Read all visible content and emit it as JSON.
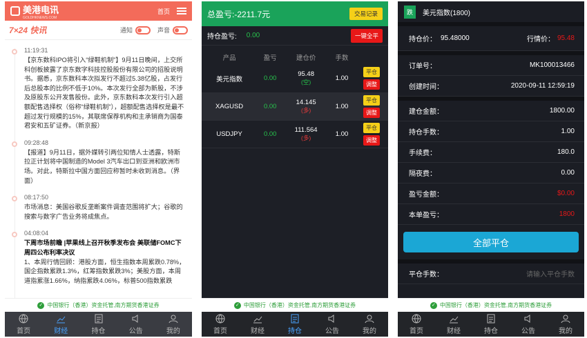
{
  "colors": {
    "brand": "#f36b5a",
    "profit_green": "#1aa35a",
    "loss_red": "#e81818",
    "accent_blue": "#1ba7d5",
    "nav_active": "#4aa3ff"
  },
  "news": {
    "logo": "美港电讯",
    "logo_sub": "GOLDHKNEWS.COM",
    "home": "首页",
    "section": "7×24 快讯",
    "toggle1": "通知",
    "toggle2": "声音",
    "items": [
      {
        "time": "11:19:31",
        "text": "【京东数科IPO将引入“绿鞋机制”】9月11日晚间，上交所科创板披露了京东数字科技控股股份有限公司的招股说明书。据悉，京东数科本次拟发行不超过5.38亿股，占发行后总股本的比例不低于10%。本次发行全部为新股，不涉及原股东公开发售股份。此外，京东数科本次发行引入超额配售选择权（俗称“绿鞋机制”），超额配售选择权是最不超过发行规模的15%，其联席保荐机构和主承销商为国泰君安和五矿证券。（新京报）"
      },
      {
        "time": "09:28:48",
        "text": "【报道】9月11日，据外媒转引两位知情人士透露，特斯拉正计划将中国制造的Model 3汽车出口到亚洲和欧洲市场。对此，特斯拉中国方面回应称暂时未收到消息。（界面）"
      },
      {
        "time": "08:17:50",
        "text": "市场消息：美国谷歌反垄断案件调查范围将扩大；谷歌的搜索与数字广告业务将成焦点。"
      },
      {
        "time": "04:08:04",
        "title": "下周市场前瞻 |苹果线上召开秋季发布会 美联储FOMC下周四公布利率决议",
        "text": "1、本周行情回顾：港股方面，恒生指数本周累跌0.78%，国企指数累跌1.3%，红筹指数累跌3%；美股方面，本周道指累涨1.66%，纳指累跌4.06%，标普500指数累跌"
      }
    ]
  },
  "banner": "中国银行（香港）资金托管,南方期货香港证券",
  "nav": [
    "首页",
    "财经",
    "持仓",
    "公告",
    "我的"
  ],
  "holdings": {
    "total_label": "总盈亏:",
    "total_value": "-2211.7元",
    "records_btn": "交易记录",
    "hold_label": "持仓盈亏:",
    "hold_value": "0.00",
    "close_all_btn": "一键全平",
    "columns": [
      "产品",
      "盈亏",
      "建仓价",
      "手数",
      ""
    ],
    "rows": [
      {
        "product": "美元指数",
        "pnl": "0.00",
        "price": "95.48",
        "dir": "(空)",
        "dir_type": "g",
        "lots": "1.00",
        "close": "平仓",
        "adjust": "调整"
      },
      {
        "product": "XAGUSD",
        "pnl": "0.00",
        "price": "14.145",
        "dir": "(多)",
        "dir_type": "r",
        "lots": "1.00",
        "close": "平仓",
        "adjust": "调整"
      },
      {
        "product": "USDJPY",
        "pnl": "0.00",
        "price": "111.564",
        "dir": "(多)",
        "dir_type": "r",
        "lots": "1.00",
        "close": "平仓",
        "adjust": "调整"
      }
    ]
  },
  "detail": {
    "badge": "跌",
    "title": "美元指数(1800)",
    "hold_price_label": "持仓价：",
    "hold_price": "95.48000",
    "market_label": "行情价：",
    "market_price": "95.48",
    "rows": [
      {
        "label": "订单号：",
        "value": "MK100013466"
      },
      {
        "label": "创建时间：",
        "value": "2020-09-11 12:59:19"
      },
      {
        "label": "建仓金额：",
        "value": "1800.00"
      },
      {
        "label": "持仓手数：",
        "value": "1.00"
      },
      {
        "label": "手续费：",
        "value": "180.0"
      },
      {
        "label": "隔夜费：",
        "value": "0.00"
      },
      {
        "label": "盈亏金额：",
        "value": "$0.00",
        "red": true
      },
      {
        "label": "本单盈亏：",
        "value": "1800",
        "red": true
      }
    ],
    "close_all": "全部平仓",
    "close_lots_label": "平仓手数：",
    "close_lots_placeholder": "请输入平仓手数"
  }
}
